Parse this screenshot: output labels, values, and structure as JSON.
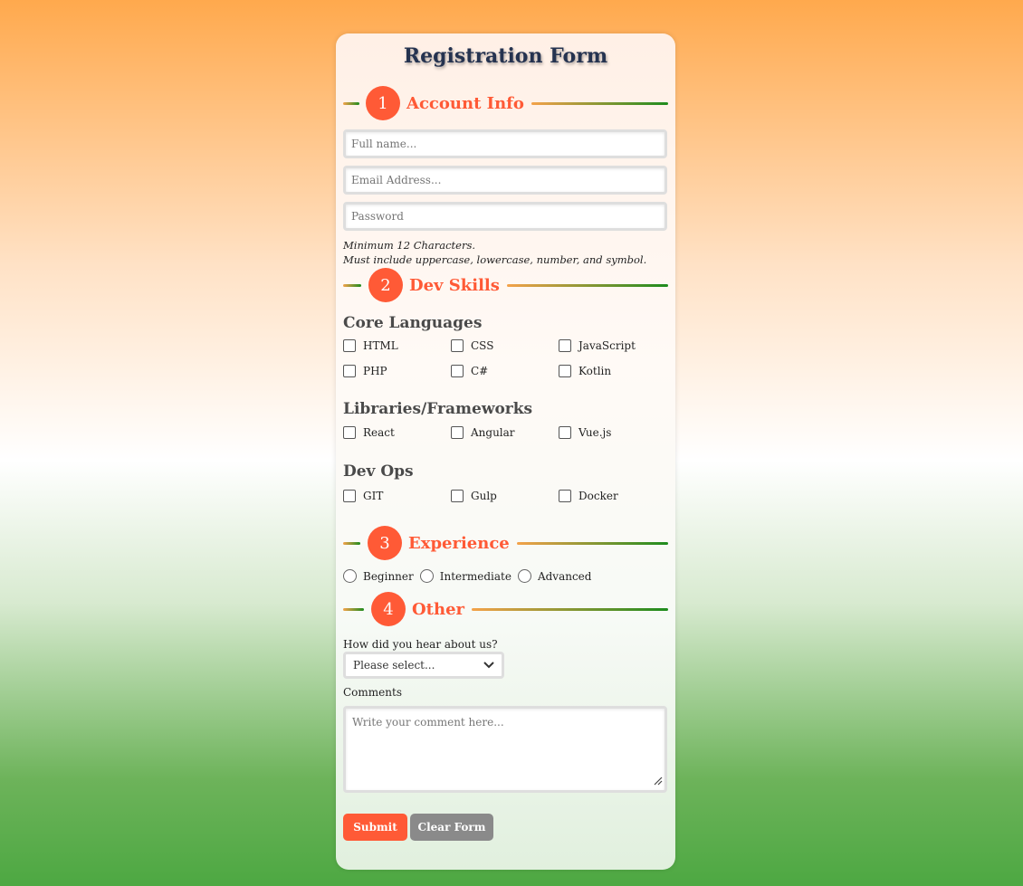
{
  "form": {
    "title": "Registration Form",
    "sections": [
      {
        "number": "1",
        "label": "Account Info"
      },
      {
        "number": "2",
        "label": "Dev Skills"
      },
      {
        "number": "3",
        "label": "Experience"
      },
      {
        "number": "4",
        "label": "Other"
      }
    ],
    "account": {
      "fullname_placeholder": "Full name...",
      "email_placeholder": "Email Address...",
      "password_placeholder": "Password",
      "hint_line1": "Minimum 12 Characters.",
      "hint_line2": "Must include uppercase, lowercase, number, and symbol."
    },
    "skills": {
      "core_title": "Core Languages",
      "core": [
        "HTML",
        "CSS",
        "JavaScript",
        "PHP",
        "C#",
        "Kotlin"
      ],
      "libs_title": "Libraries/Frameworks",
      "libs": [
        "React",
        "Angular",
        "Vue.js"
      ],
      "devops_title": "Dev Ops",
      "devops": [
        "GIT",
        "Gulp",
        "Docker"
      ]
    },
    "experience": [
      "Beginner",
      "Intermediate",
      "Advanced"
    ],
    "other": {
      "hear_label": "How did you hear about us?",
      "hear_selected": "Please select...",
      "comments_label": "Comments",
      "comments_placeholder": "Write your comment here..."
    },
    "buttons": {
      "submit": "Submit",
      "clear": "Clear Form"
    }
  },
  "colors": {
    "accent": "#ff5a36",
    "title": "#253350",
    "clear_button": "#8a8a8a"
  },
  "icons": {
    "select_arrow": "chevron-down-icon",
    "resize": "resize-handle-icon"
  }
}
